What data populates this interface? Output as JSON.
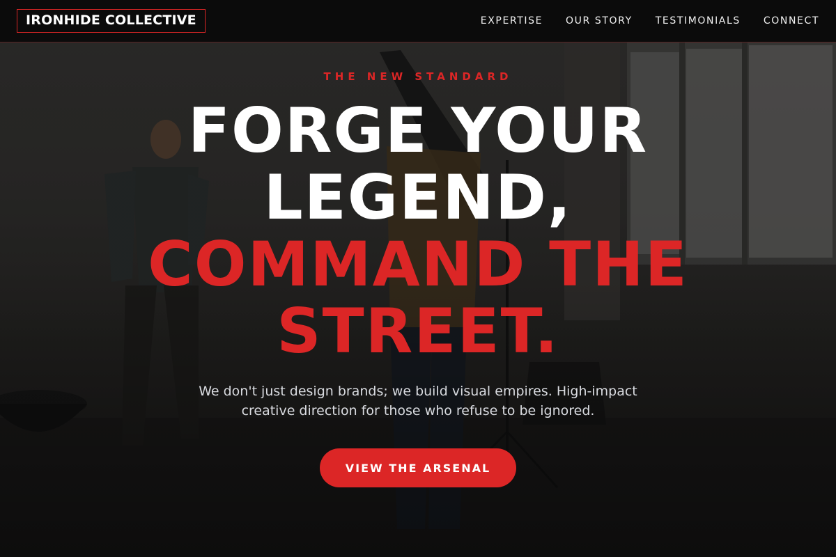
{
  "header": {
    "logo": "IRONHIDE COLLECTIVE",
    "nav": [
      {
        "label": "EXPERTISE"
      },
      {
        "label": "OUR STORY"
      },
      {
        "label": "TESTIMONIALS"
      },
      {
        "label": "CONNECT"
      }
    ]
  },
  "hero": {
    "eyebrow": "THE NEW STANDARD",
    "headline_white_1": "FORGE YOUR",
    "headline_white_2": "LEGEND,",
    "headline_red_1": "COMMAND THE",
    "headline_red_2": "STREET.",
    "subtext_1": "We don't just design brands; we build visual empires. High-impact",
    "subtext_2": "creative direction for those who refuse to be ignored.",
    "cta_label": "VIEW THE ARSENAL"
  },
  "colors": {
    "accent": "#dc2626",
    "nav_bg": "#0b0b0b",
    "text_primary": "#ffffff",
    "text_muted": "#d9dbe0"
  }
}
